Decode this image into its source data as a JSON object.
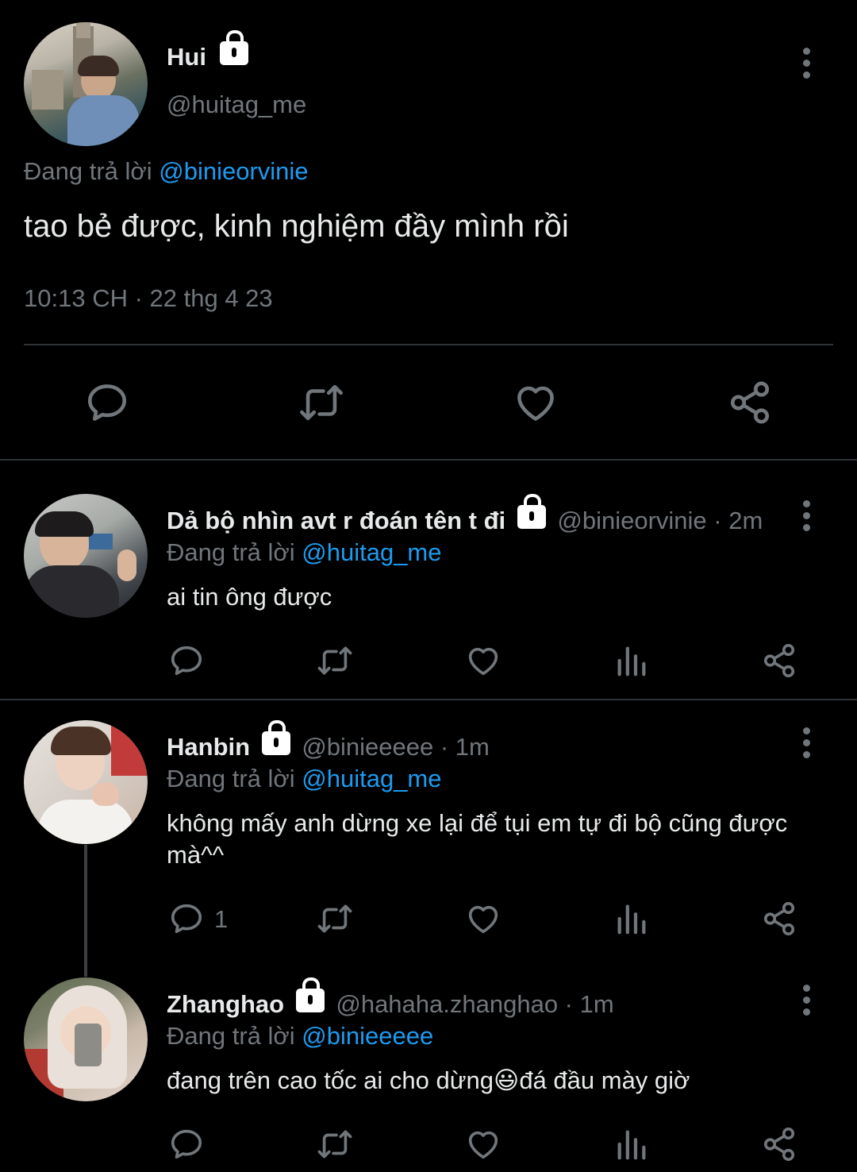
{
  "main_tweet": {
    "name": "Hui",
    "handle": "@huitag_me",
    "reply_prefix": "Đang trả lời",
    "reply_to": "@binieorvinie",
    "text": "tao bẻ được, kinh nghiệm đầy mình rồi",
    "timestamp": "10:13 CH · 22 thg 4 23"
  },
  "replies": [
    {
      "name": "Dả bộ nhìn avt r đoán tên t đi",
      "handle_time": "@binieorvinie · 2m",
      "reply_prefix": "Đang trả lời",
      "reply_to": "@huitag_me",
      "text": "ai tin ông được",
      "reply_count": ""
    },
    {
      "name": "Hanbin",
      "handle_time": "@binieeeee · 1m",
      "reply_prefix": "Đang trả lời",
      "reply_to": "@huitag_me",
      "text": "không mấy anh dừng xe lại để tụi em tự đi bộ cũng được mà^^",
      "reply_count": "1"
    },
    {
      "name": "Zhanghao",
      "handle_time": "@hahaha.zhanghao · 1m",
      "reply_prefix": "Đang trả lời",
      "reply_to": "@binieeeee",
      "text_before": "đang trên cao tốc ai cho dừng",
      "emoji": "😃",
      "text_after": "đá đầu mày giờ",
      "reply_count": ""
    }
  ],
  "colors": {
    "background": "#000000",
    "text": "#e7e9ea",
    "secondary": "#71767b",
    "link": "#1d9bf0",
    "divider": "#2f3336"
  }
}
